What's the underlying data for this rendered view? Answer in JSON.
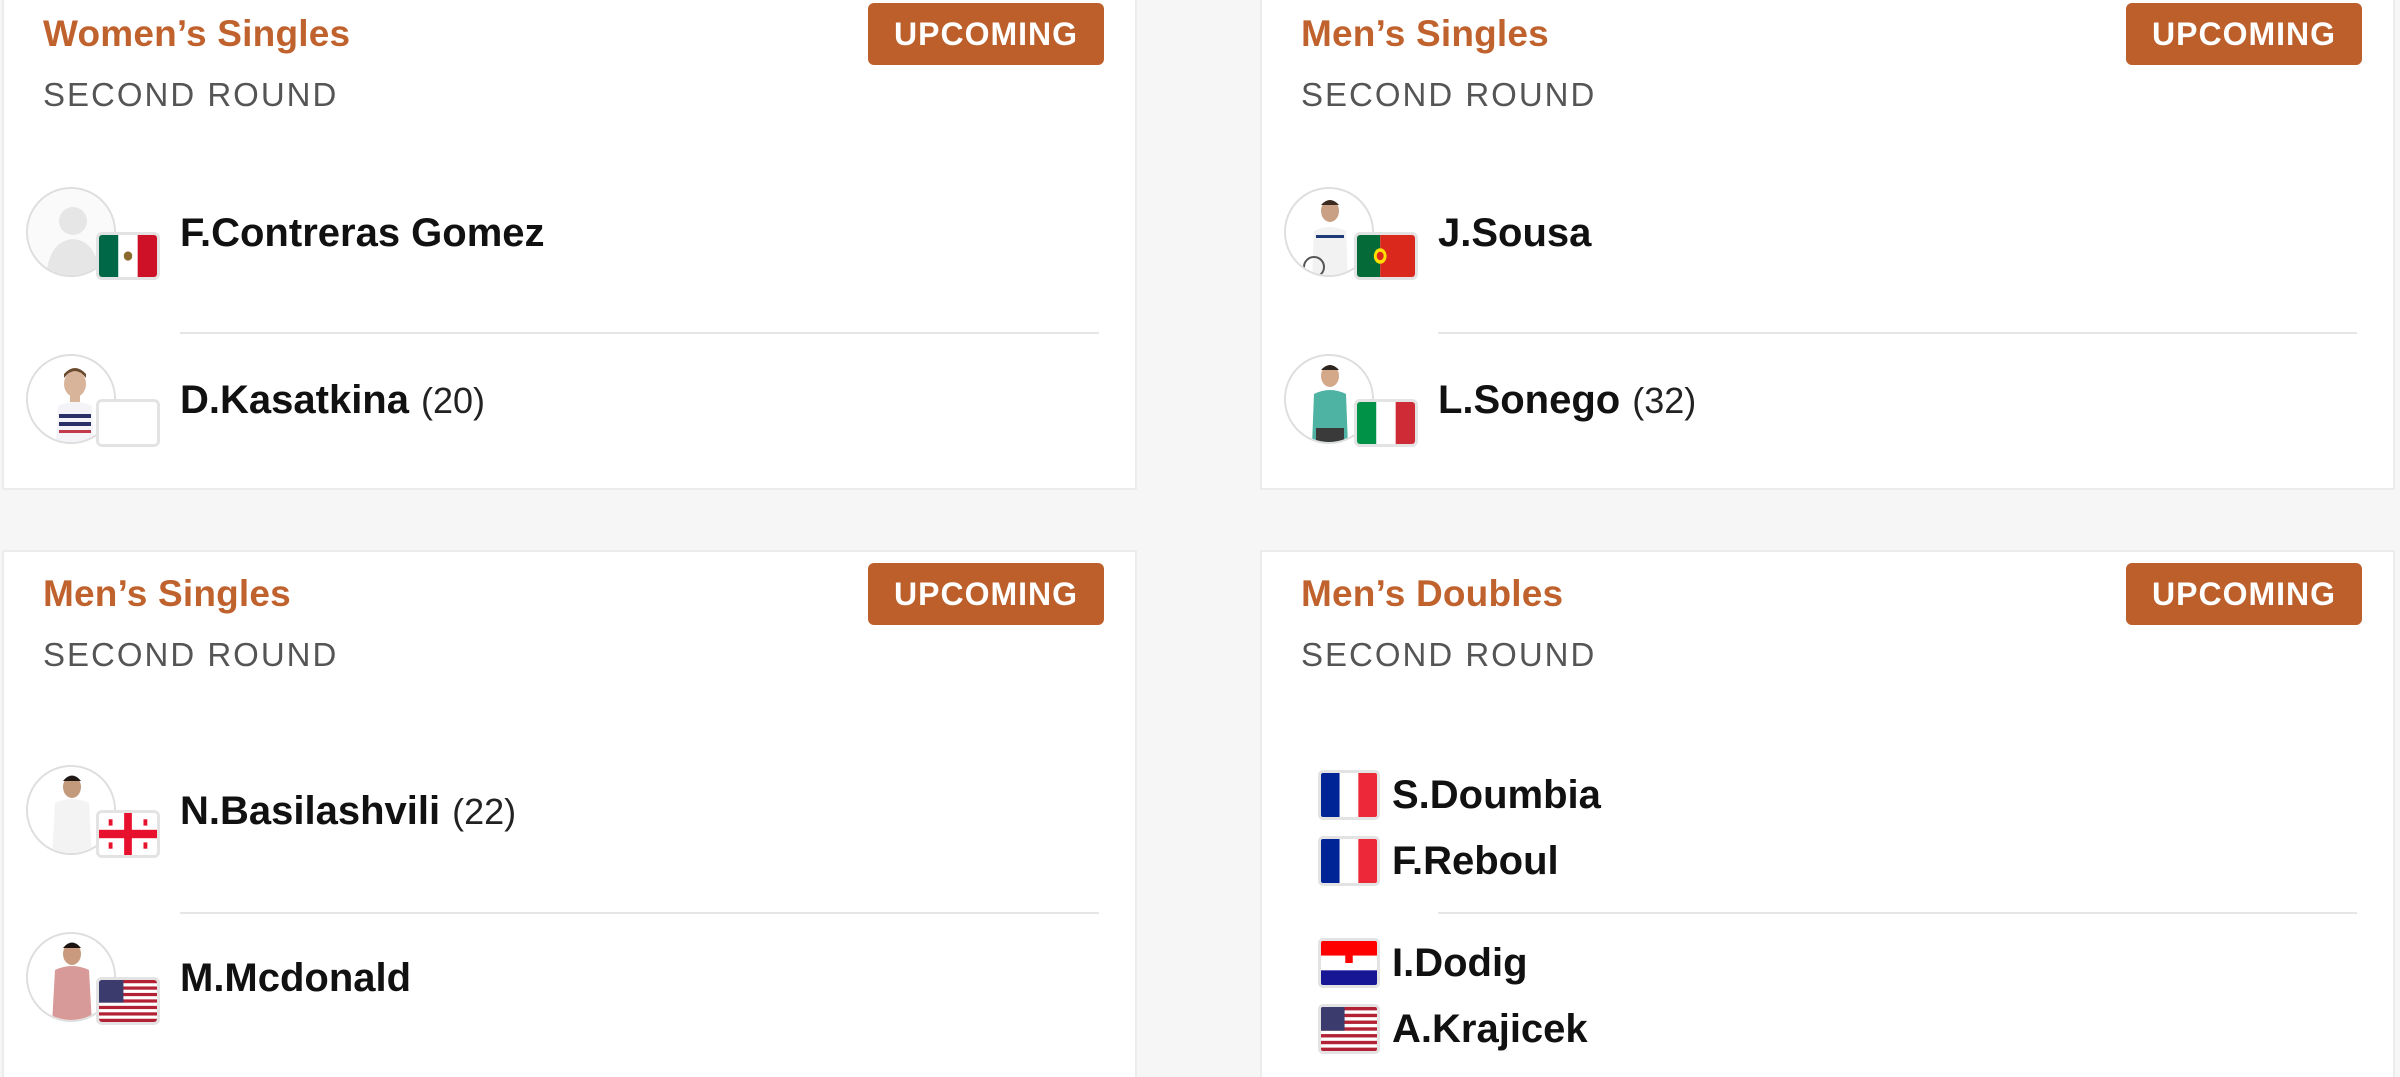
{
  "colors": {
    "accent": "#c0622e",
    "badge_bg": "#bd5f2b"
  },
  "matches": [
    {
      "event": "Women’s Singles",
      "round": "SECOND ROUND",
      "status": "UPCOMING",
      "players": [
        {
          "name": "F.Contreras Gomez",
          "seed": "",
          "flag": "mexico-flag-icon",
          "photo": "silhouette"
        },
        {
          "name": "D.Kasatkina",
          "seed": "(20)",
          "flag": "blank-flag-icon",
          "photo": "player-photo"
        }
      ]
    },
    {
      "event": "Men’s Singles",
      "round": "SECOND ROUND",
      "status": "UPCOMING",
      "players": [
        {
          "name": "J.Sousa",
          "seed": "",
          "flag": "portugal-flag-icon",
          "photo": "player-photo"
        },
        {
          "name": "L.Sonego",
          "seed": "(32)",
          "flag": "italy-flag-icon",
          "photo": "player-photo"
        }
      ]
    },
    {
      "event": "Men’s Singles",
      "round": "SECOND ROUND",
      "status": "UPCOMING",
      "players": [
        {
          "name": "N.Basilashvili",
          "seed": "(22)",
          "flag": "georgia-flag-icon",
          "photo": "player-photo"
        },
        {
          "name": "M.Mcdonald",
          "seed": "",
          "flag": "usa-flag-icon",
          "photo": "player-photo"
        }
      ]
    },
    {
      "event": "Men’s Doubles",
      "round": "SECOND ROUND",
      "status": "UPCOMING",
      "teams": [
        [
          {
            "name": "S.Doumbia",
            "flag": "france-flag-icon"
          },
          {
            "name": "F.Reboul",
            "flag": "france-flag-icon"
          }
        ],
        [
          {
            "name": "I.Dodig",
            "flag": "croatia-flag-icon"
          },
          {
            "name": "A.Krajicek",
            "flag": "usa-flag-icon"
          }
        ]
      ]
    }
  ]
}
